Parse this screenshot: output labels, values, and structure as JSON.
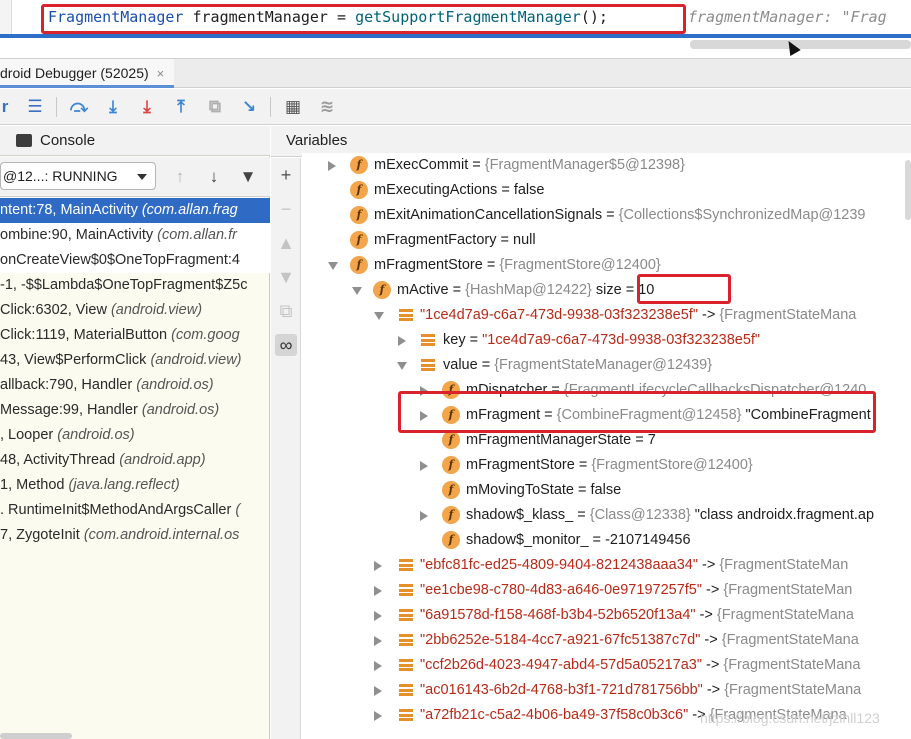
{
  "editor": {
    "code_type": "FragmentManager",
    "code_var": " fragmentManager = ",
    "code_method": "getSupportFragmentManager",
    "code_end": "();",
    "inline_hint": "fragmentManager: \"Frag"
  },
  "debugger_tab": {
    "label": "droid Debugger (52025)",
    "close": "×"
  },
  "toolbar": {
    "icons": [
      "menu-icon",
      "step-over-icon",
      "step-into-icon",
      "force-step-into-icon",
      "step-out-icon",
      "drop-frame-icon",
      "run-to-cursor-icon",
      "evaluate-icon",
      "trace-icon"
    ]
  },
  "left_panel": {
    "console_label": "Console",
    "thread_select": "@12...: RUNNING",
    "frames": [
      {
        "text": "ntent:78, MainActivity ",
        "pkg": "(com.allan.frag"
      },
      {
        "text": "ombine:90, MainActivity ",
        "pkg": "(com.allan.fr"
      },
      {
        "text": "onCreateView$0$OneTopFragment:4",
        "pkg": ""
      },
      {
        "text": "-1, -$$Lambda$OneTopFragment$Z5c",
        "pkg": ""
      },
      {
        "text": "Click:6302, View ",
        "pkg": "(android.view)"
      },
      {
        "text": "Click:1119, MaterialButton ",
        "pkg": "(com.goog"
      },
      {
        "text": "43, View$PerformClick ",
        "pkg": "(android.view)"
      },
      {
        "text": "allback:790, Handler ",
        "pkg": "(android.os)"
      },
      {
        "text": "Message:99, Handler ",
        "pkg": "(android.os)"
      },
      {
        "text": ", Looper ",
        "pkg": "(android.os)"
      },
      {
        "text": "48, ActivityThread ",
        "pkg": "(android.app)"
      },
      {
        "text": "1, Method ",
        "pkg": "(java.lang.reflect)"
      },
      {
        "text": ". RuntimeInit$MethodAndArgsCaller ",
        "pkg": "("
      },
      {
        "text": "7, ZygoteInit ",
        "pkg": "(com.android.internal.os"
      }
    ]
  },
  "variables": {
    "title": "Variables",
    "rows": [
      {
        "name": "mExecCommit",
        "eq": " = ",
        "type": "{FragmentManager$5@12398}",
        "val": ""
      },
      {
        "name": "mExecutingActions",
        "eq": " = ",
        "type": "",
        "val": "false"
      },
      {
        "name": "mExitAnimationCancellationSignals",
        "eq": " = ",
        "type": "{Collections$SynchronizedMap@1239",
        "val": ""
      },
      {
        "name": "mFragmentFactory",
        "eq": " = ",
        "type": "",
        "val": "null"
      },
      {
        "name": "mFragmentStore",
        "eq": " = ",
        "type": "{FragmentStore@12400}",
        "val": ""
      },
      {
        "name": "mActive",
        "eq": " = ",
        "type": "{HashMap@12422}",
        "val": "  size = 10"
      },
      {
        "name": "\"1ce4d7a9-c6a7-473d-9938-03f323238e5f\"",
        "eq": " -> ",
        "type": "{FragmentStateMana",
        "val": ""
      },
      {
        "name": "key",
        "eq": " = ",
        "type": "",
        "val": "\"1ce4d7a9-c6a7-473d-9938-03f323238e5f\""
      },
      {
        "name": "value",
        "eq": " = ",
        "type": "{FragmentStateManager@12439}",
        "val": ""
      },
      {
        "name": "mDispatcher",
        "eq": " = ",
        "type": "{FragmentLifecycleCallbacksDispatcher@1240",
        "val": ""
      },
      {
        "name": "mFragment",
        "eq": " = ",
        "type": "{CombineFragment@12458}",
        "val": " \"CombineFragment"
      },
      {
        "name": "mFragmentManagerState",
        "eq": " = ",
        "type": "",
        "val": "7"
      },
      {
        "name": "mFragmentStore",
        "eq": " = ",
        "type": "{FragmentStore@12400}",
        "val": ""
      },
      {
        "name": "mMovingToState",
        "eq": " = ",
        "type": "",
        "val": "false"
      },
      {
        "name": "shadow$_klass_",
        "eq": " = ",
        "type": "{Class@12338}",
        "val": " \"class androidx.fragment.ap"
      },
      {
        "name": "shadow$_monitor_",
        "eq": " = ",
        "type": "",
        "val": "-2107149456"
      },
      {
        "name": "\"ebfc81fc-ed25-4809-9404-8212438aaa34\"",
        "eq": " -> ",
        "type": "{FragmentStateMan",
        "val": ""
      },
      {
        "name": "\"ee1cbe98-c780-4d83-a646-0e97197257f5\"",
        "eq": " -> ",
        "type": "{FragmentStateMan",
        "val": ""
      },
      {
        "name": "\"6a91578d-f158-468f-b3b4-52b6520f13a4\"",
        "eq": " -> ",
        "type": "{FragmentStateMana",
        "val": ""
      },
      {
        "name": "\"2bb6252e-5184-4cc7-a921-67fc51387c7d\"",
        "eq": " -> ",
        "type": "{FragmentStateMana",
        "val": ""
      },
      {
        "name": "\"ccf2b26d-4023-4947-abd4-57d5a05217a3\"",
        "eq": " -> ",
        "type": "{FragmentStateMana",
        "val": ""
      },
      {
        "name": "\"ac016143-6b2d-4768-b3f1-721d781756bb\"",
        "eq": " -> ",
        "type": "{FragmentStateMana",
        "val": ""
      },
      {
        "name": "\"a72fb21c-c5a2-4b06-ba49-37f58c0b3c6\"",
        "eq": " -> ",
        "type": "{FragmentStateMana",
        "val": ""
      }
    ]
  },
  "watermark": "https://blog.csdn.net/jzlhll123",
  "colors": {
    "accent": "#2f6bc5",
    "highlight": "#d9222b",
    "field_icon": "#f2a54a"
  }
}
